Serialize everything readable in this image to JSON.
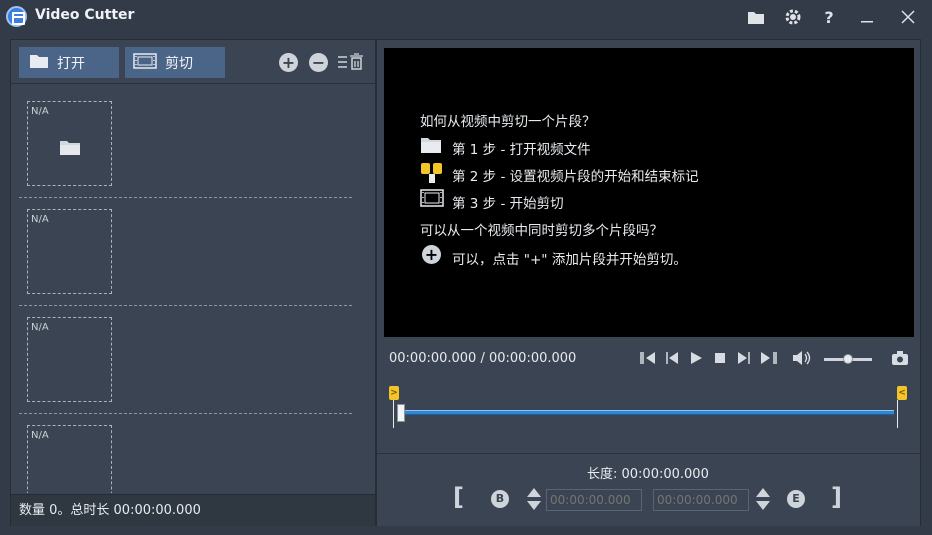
{
  "window": {
    "title": "Video Cutter"
  },
  "left": {
    "open_label": "打开",
    "cut_label": "剪切",
    "slots": [
      {
        "label": "N/A",
        "icon": "folder-icon"
      },
      {
        "label": "N/A"
      },
      {
        "label": "N/A"
      },
      {
        "label": "N/A"
      }
    ],
    "status": "数量 0。总时长 00:00:00.000"
  },
  "video": {
    "help_title": "如何从视频中剪切一个片段？",
    "step1": "第 1 步 - 打开视频文件",
    "step2": "第 2 步 - 设置视频片段的开始和结束标记",
    "step3": "第 3 步 - 开始剪切",
    "q2": "可以从一个视频中同时剪切多个片段吗？",
    "a2": "可以，点击 \"+\" 添加片段并开始剪切。"
  },
  "player": {
    "time": "00:00:00.000 / 00:00:00.000",
    "volume": 0.5
  },
  "trim": {
    "length_label": "长度: 00:00:00.000",
    "start_placeholder": "00:00:00.000",
    "end_placeholder": "00:00:00.000",
    "begin_btn": "B",
    "end_btn": "E",
    "open_bracket": "[",
    "close_bracket": "]"
  },
  "colors": {
    "accent": "#4a6588",
    "track": "#2f86d1",
    "marker": "#f4c52a"
  }
}
